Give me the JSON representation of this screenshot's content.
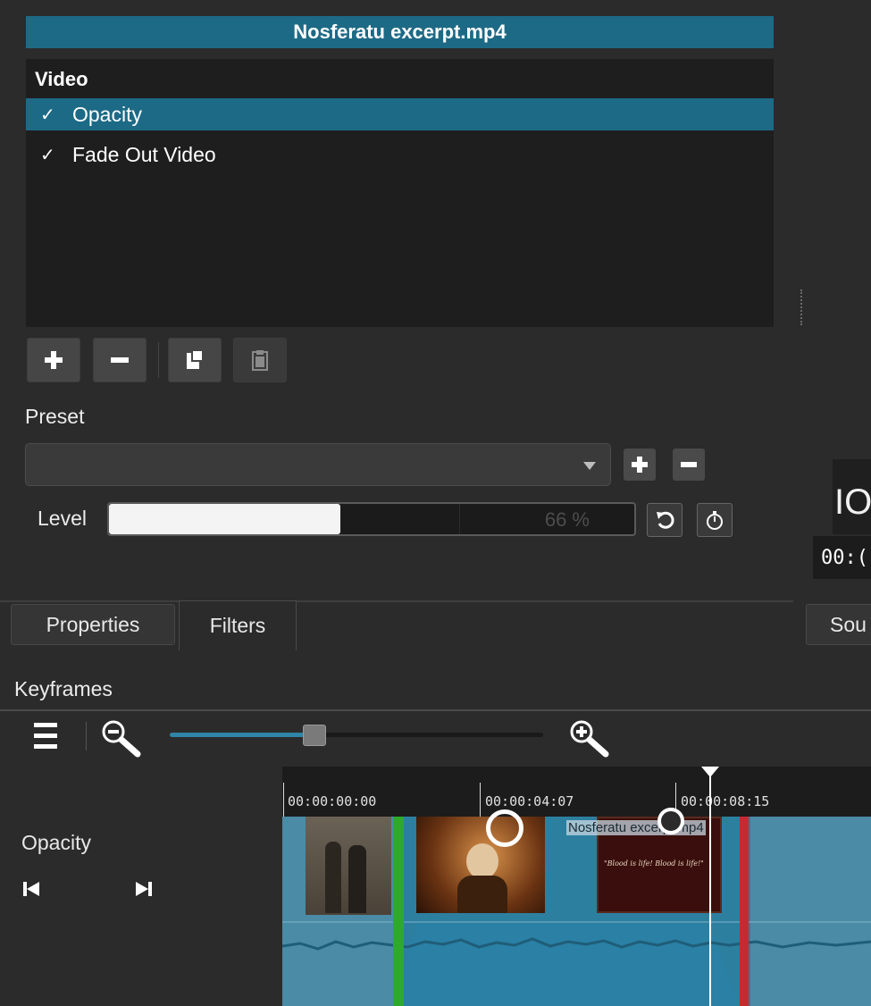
{
  "clip": {
    "title": "Nosferatu excerpt.mp4"
  },
  "filters": {
    "section": "Video",
    "items": [
      {
        "label": "Opacity",
        "checked": true,
        "selected": true
      },
      {
        "label": "Fade Out Video",
        "checked": true,
        "selected": false
      }
    ],
    "check_glyph": "✓"
  },
  "toolbar": {
    "icons": [
      "add-icon",
      "remove-icon",
      "copy-icon",
      "paste-icon"
    ]
  },
  "preset": {
    "label": "Preset",
    "value": ""
  },
  "level": {
    "label": "Level",
    "value_text": "66 %",
    "fraction": 0.66
  },
  "tabs": [
    {
      "label": "Properties",
      "active": false
    },
    {
      "label": "Filters",
      "active": true
    }
  ],
  "right_panel": {
    "partial_tab": "Sou",
    "partial_timecode": "00:(",
    "partial_big": "ΙΟ("
  },
  "keyframes": {
    "title": "Keyframes",
    "zoom": 0.38,
    "ruler_labels": [
      "00:00:00:00",
      "00:00:04:07",
      "00:00:08:15"
    ],
    "track_name": "Opacity",
    "clip_label": "Nosferatu excerpt.mp4",
    "frame_caption": "\"Blood is life! Blood is life!\""
  },
  "colors": {
    "accent": "#1d6a86",
    "track": "#4b8ba6",
    "fade_in": "#2ea82e",
    "fade_out": "#c42c2c"
  }
}
